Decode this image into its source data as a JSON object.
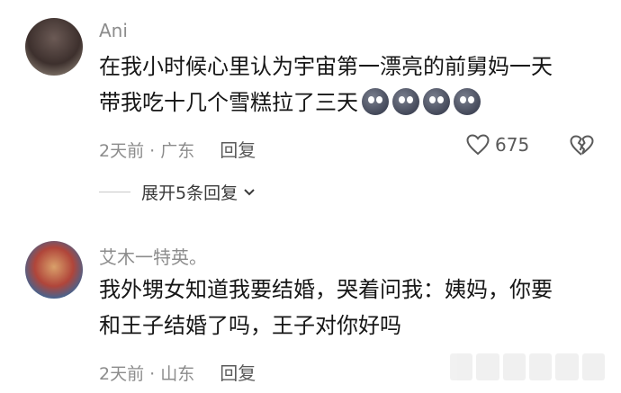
{
  "comments": [
    {
      "username": "Ani",
      "text_line1": "在我小时候心里认为宇宙第一漂亮的前舅妈一天",
      "text_line2": "带我吃十几个雪糕拉了三天",
      "emojis": [
        "sweating-face-emoji",
        "sweating-face-emoji",
        "sweating-face-emoji",
        "sweating-face-emoji"
      ],
      "meta": "2天前 · 广东",
      "reply_label": "回复",
      "like_count": "675",
      "expand_label": "展开5条回复"
    },
    {
      "username": "艾木一特英。",
      "text_line1": "我外甥女知道我要结婚，哭着问我：姨妈，你要",
      "text_line2": "和王子结婚了吗，王子对你好吗",
      "meta": "2天前 · 山东",
      "reply_label": "回复"
    }
  ],
  "colors": {
    "text": "#161616",
    "secondary": "#8c8c8c",
    "background": "#ffffff"
  }
}
